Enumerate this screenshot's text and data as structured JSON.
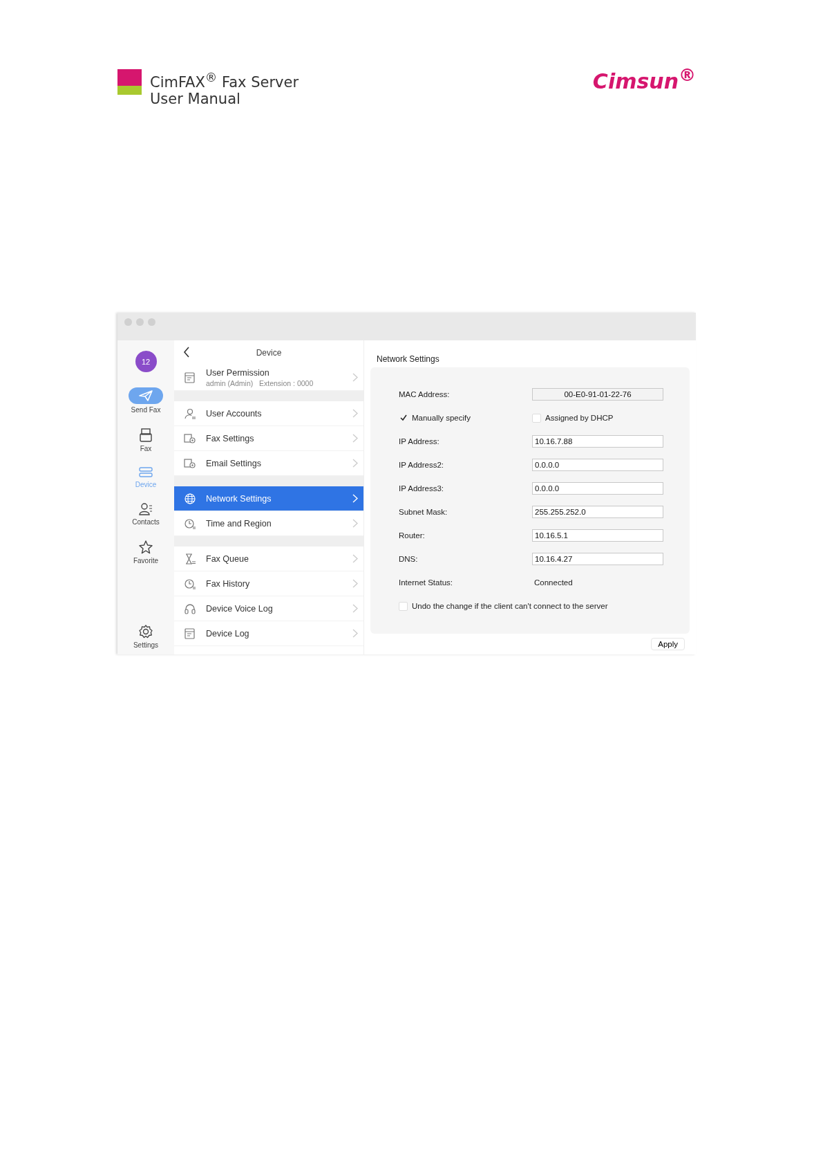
{
  "header": {
    "title": "CimFAX$^{®}$ Fax Server",
    "subtitle": "User Manual",
    "brand": "Cimsun$^{®}$"
  },
  "nav": {
    "badge": "12",
    "items": [
      {
        "kind": "send",
        "label": "Send Fax",
        "selected": false
      },
      {
        "kind": "fax",
        "label": "Fax",
        "selected": false
      },
      {
        "kind": "device",
        "label": "Device",
        "selected": true
      },
      {
        "kind": "contacts",
        "label": "Contacts",
        "selected": false
      },
      {
        "kind": "favorite",
        "label": "Favorite",
        "selected": false
      },
      {
        "kind": "settings",
        "label": "Settings",
        "selected": false
      }
    ]
  },
  "list": {
    "title": "Device",
    "groups": [
      [
        {
          "kind": "permission",
          "label": "User Permission",
          "detail": "admin (Admin)   Extension : 0000",
          "selected": false
        }
      ],
      [
        {
          "kind": "accounts",
          "label": "User Accounts",
          "selected": false
        },
        {
          "kind": "faxgear",
          "label": "Fax Settings",
          "selected": false
        },
        {
          "kind": "mailgear",
          "label": "Email Settings",
          "selected": false
        }
      ],
      [
        {
          "kind": "globe",
          "label": "Network Settings",
          "selected": true
        },
        {
          "kind": "clock",
          "label": "Time and Region",
          "selected": false
        }
      ],
      [
        {
          "kind": "hourglass",
          "label": "Fax Queue",
          "selected": false
        },
        {
          "kind": "history",
          "label": "Fax History",
          "selected": false
        },
        {
          "kind": "headset",
          "label": "Device Voice Log",
          "selected": false
        },
        {
          "kind": "log",
          "label": "Device Log",
          "selected": false
        }
      ]
    ]
  },
  "content": {
    "title": "Network Settings",
    "rows": [
      {
        "kind": "readonly",
        "label": "MAC Address:",
        "value": "00-E0-91-01-22-76"
      },
      {
        "kind": "options",
        "options": [
          {
            "label": "Manually specify",
            "checked": true
          },
          {
            "label": "Assigned by DHCP",
            "checked": false
          }
        ]
      },
      {
        "kind": "field",
        "label": "IP Address:",
        "value": "10.16.7.88"
      },
      {
        "kind": "field",
        "label": "IP Address2:",
        "value": "0.0.0.0"
      },
      {
        "kind": "field",
        "label": "IP Address3:",
        "value": "0.0.0.0"
      },
      {
        "kind": "field",
        "label": "Subnet Mask:",
        "value": "255.255.252.0"
      },
      {
        "kind": "field",
        "label": "Router:",
        "value": "10.16.5.1"
      },
      {
        "kind": "field",
        "label": "DNS:",
        "value": "10.16.4.27"
      },
      {
        "kind": "status",
        "label": "Internet Status:",
        "value": "Connected"
      },
      {
        "kind": "check",
        "label": "Undo the change if the client can't connect to the server",
        "checked": false
      }
    ],
    "apply": "Apply"
  }
}
